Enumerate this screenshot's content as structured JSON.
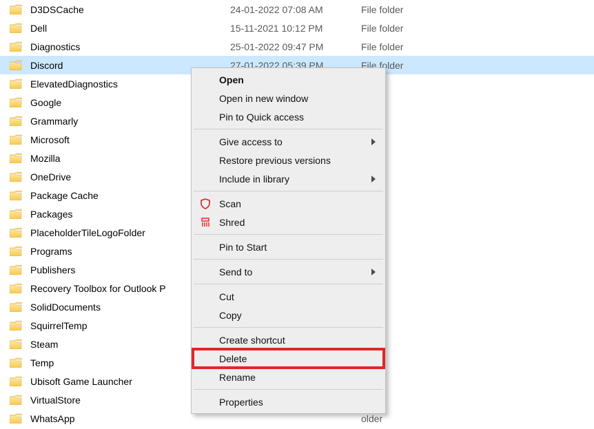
{
  "type_label": "File folder",
  "files": [
    {
      "name": "D3DSCache",
      "date": "24-01-2022 07:08 AM",
      "selected": false
    },
    {
      "name": "Dell",
      "date": "15-11-2021 10:12 PM",
      "selected": false
    },
    {
      "name": "Diagnostics",
      "date": "25-01-2022 09:47 PM",
      "selected": false
    },
    {
      "name": "Discord",
      "date": "27-01-2022 05:39 PM",
      "selected": true
    },
    {
      "name": "ElevatedDiagnostics",
      "date": "",
      "selected": false
    },
    {
      "name": "Google",
      "date": "",
      "selected": false
    },
    {
      "name": "Grammarly",
      "date": "",
      "selected": false
    },
    {
      "name": "Microsoft",
      "date": "",
      "selected": false
    },
    {
      "name": "Mozilla",
      "date": "",
      "selected": false
    },
    {
      "name": "OneDrive",
      "date": "",
      "selected": false
    },
    {
      "name": "Package Cache",
      "date": "",
      "selected": false
    },
    {
      "name": "Packages",
      "date": "",
      "selected": false
    },
    {
      "name": "PlaceholderTileLogoFolder",
      "date": "",
      "selected": false
    },
    {
      "name": "Programs",
      "date": "",
      "selected": false
    },
    {
      "name": "Publishers",
      "date": "",
      "selected": false
    },
    {
      "name": "Recovery Toolbox for Outlook P",
      "date": "",
      "selected": false
    },
    {
      "name": "SolidDocuments",
      "date": "",
      "selected": false
    },
    {
      "name": "SquirrelTemp",
      "date": "",
      "selected": false
    },
    {
      "name": "Steam",
      "date": "",
      "selected": false
    },
    {
      "name": "Temp",
      "date": "",
      "selected": false
    },
    {
      "name": "Ubisoft Game Launcher",
      "date": "",
      "selected": false
    },
    {
      "name": "VirtualStore",
      "date": "",
      "selected": false
    },
    {
      "name": "WhatsApp",
      "date": "",
      "selected": false
    }
  ],
  "type_obscured": "older",
  "context_menu": {
    "open": "Open",
    "open_new_window": "Open in new window",
    "pin_quick_access": "Pin to Quick access",
    "give_access_to": "Give access to",
    "restore_previous": "Restore previous versions",
    "include_in_library": "Include in library",
    "scan": "Scan",
    "shred": "Shred",
    "pin_to_start": "Pin to Start",
    "send_to": "Send to",
    "cut": "Cut",
    "copy": "Copy",
    "create_shortcut": "Create shortcut",
    "delete": "Delete",
    "rename": "Rename",
    "properties": "Properties"
  }
}
